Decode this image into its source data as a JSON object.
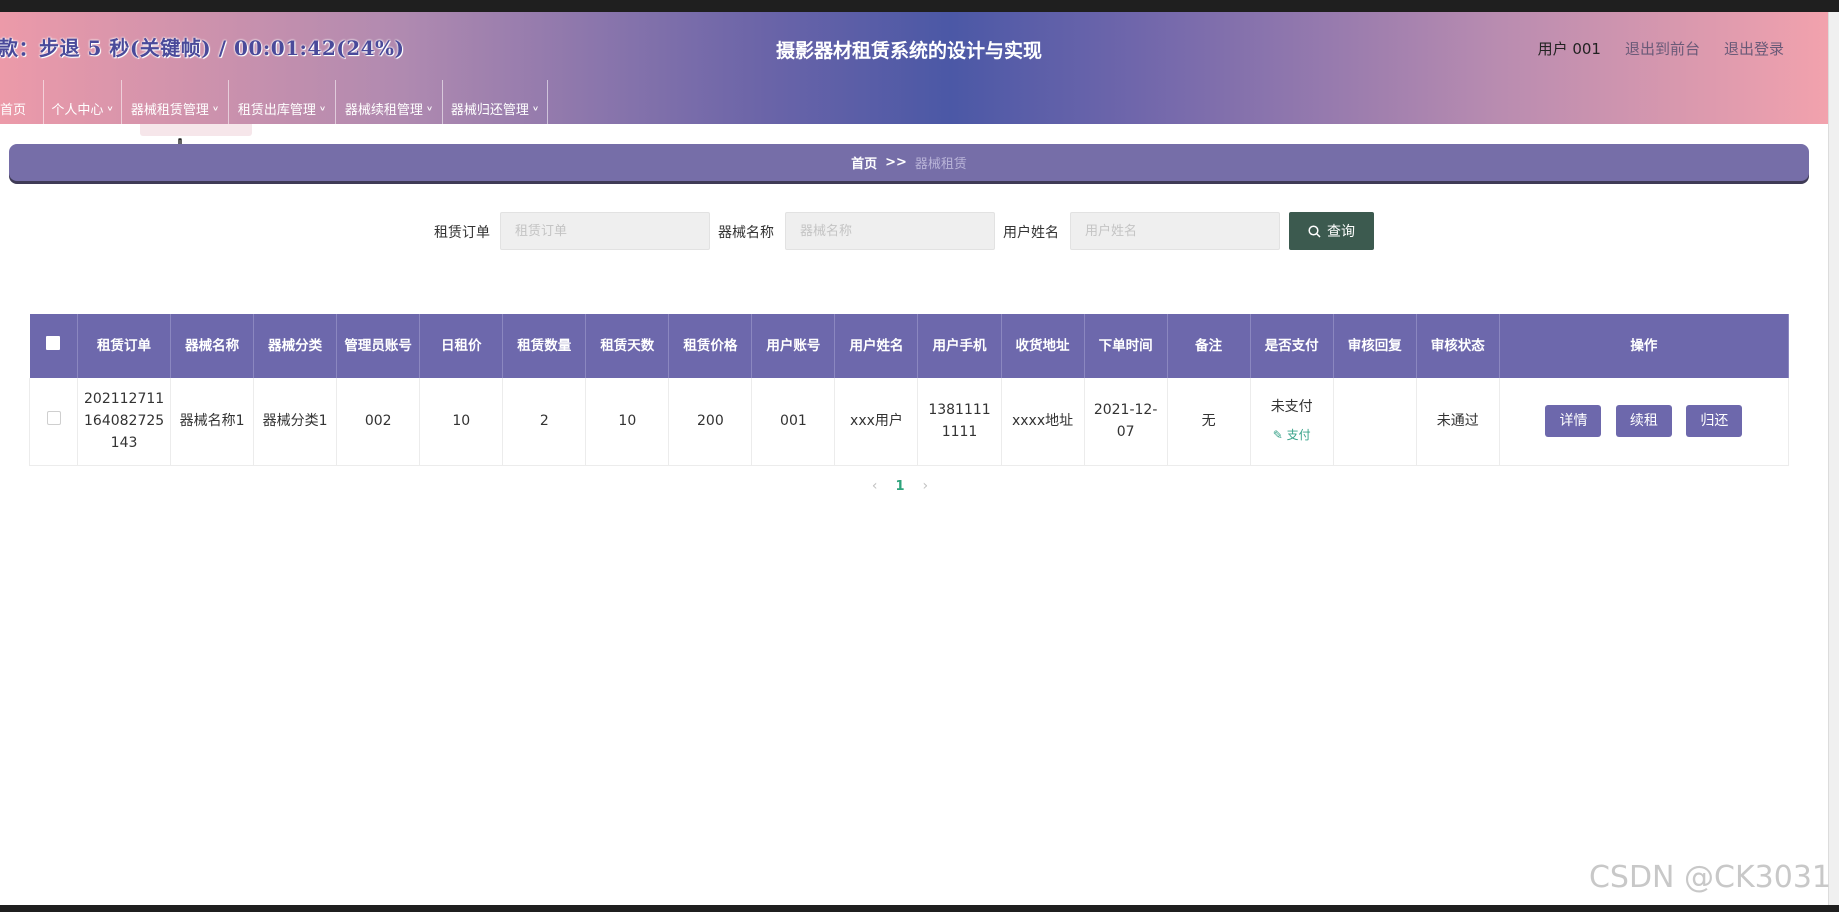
{
  "overlay": {
    "text": "款：步退 5 秒(关键帧) / 00:01:42(24%)"
  },
  "header": {
    "title": "摄影器材租赁系统的设计与实现",
    "user": "用户 001",
    "back_front": "退出到前台",
    "logout": "退出登录"
  },
  "nav": {
    "items": [
      {
        "label": "首页"
      },
      {
        "label": "个人中心"
      },
      {
        "label": "器械租赁管理"
      },
      {
        "label": "租赁出库管理"
      },
      {
        "label": "器械续租管理"
      },
      {
        "label": "器械归还管理"
      }
    ]
  },
  "breadcrumb": {
    "home": "首页",
    "sep": ">>",
    "current": "器械租赁"
  },
  "search": {
    "order_label": "租赁订单",
    "order_placeholder": "租赁订单",
    "equipment_label": "器械名称",
    "equipment_placeholder": "器械名称",
    "username_label": "用户姓名",
    "username_placeholder": "用户姓名",
    "query_label": "查询"
  },
  "table": {
    "headers": [
      "租赁订单",
      "器械名称",
      "器械分类",
      "管理员账号",
      "日租价",
      "租赁数量",
      "租赁天数",
      "租赁价格",
      "用户账号",
      "用户姓名",
      "用户手机",
      "收货地址",
      "下单时间",
      "备注",
      "是否支付",
      "审核回复",
      "审核状态",
      "操作"
    ],
    "rows": [
      {
        "order_line1": "202112711",
        "order_line2": "164082725",
        "order_line3": "143",
        "equipment": "器械名称1",
        "category": "器械分类1",
        "admin": "002",
        "daily_price": "10",
        "quantity": "2",
        "days": "10",
        "price": "200",
        "user_account": "001",
        "user_name": "xxx用户",
        "phone_line1": "1381111",
        "phone_line2": "1111",
        "address": "xxxx地址",
        "date_line1": "2021-12-",
        "date_line2": "07",
        "remark": "无",
        "paid": "未支付",
        "pay_link": "支付",
        "reply": "",
        "status": "未通过",
        "actions": {
          "detail": "详情",
          "renew": "续租",
          "return": "归还"
        }
      }
    ]
  },
  "pager": {
    "prev": "‹",
    "current": "1",
    "next": "›"
  },
  "watermark": "CSDN @CK3031",
  "colors": {
    "accent": "#6d68ac",
    "query_button": "#3c5a4f",
    "pay_link": "#3aa38a"
  }
}
